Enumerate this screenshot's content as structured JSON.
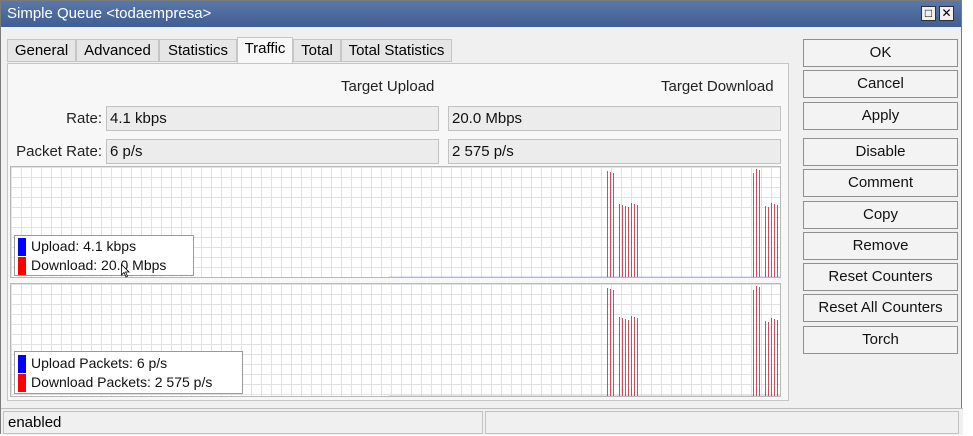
{
  "window": {
    "title": "Simple Queue <todaempresa>",
    "restore_glyph": "□",
    "close_glyph": "✕"
  },
  "tabs": [
    {
      "label": "General",
      "active": false
    },
    {
      "label": "Advanced",
      "active": false
    },
    {
      "label": "Statistics",
      "active": false
    },
    {
      "label": "Traffic",
      "active": true
    },
    {
      "label": "Total",
      "active": false
    },
    {
      "label": "Total Statistics",
      "active": false
    }
  ],
  "traffic": {
    "header_upload": "Target Upload",
    "header_download": "Target Download",
    "rate_label": "Rate:",
    "rate_upload": "4.1 kbps",
    "rate_download": "20.0 Mbps",
    "packet_rate_label": "Packet Rate:",
    "packet_rate_upload": "6 p/s",
    "packet_rate_download": "2 575 p/s"
  },
  "graphs": [
    {
      "legend": [
        {
          "text": "Upload:  4.1 kbps",
          "color": "#0000ff"
        },
        {
          "text": "Download:  20.0 Mbps",
          "color": "#ff0000"
        }
      ]
    },
    {
      "legend": [
        {
          "text": "Upload Packets:  6 p/s",
          "color": "#0000ff"
        },
        {
          "text": "Download Packets:  2 575 p/s",
          "color": "#ff0000"
        }
      ]
    }
  ],
  "buttons": [
    {
      "label": "OK"
    },
    {
      "label": "Cancel"
    },
    {
      "label": "Apply"
    },
    {
      "label": "Disable"
    },
    {
      "label": "Comment"
    },
    {
      "label": "Copy"
    },
    {
      "label": "Remove"
    },
    {
      "label": "Reset Counters"
    },
    {
      "label": "Reset All Counters"
    },
    {
      "label": "Torch"
    }
  ],
  "status": {
    "text": "enabled",
    "extra": ""
  },
  "colors": {
    "title_bar": "#4a6a9f",
    "download_series": "#c0304a",
    "upload_series": "#3050c0",
    "grid": "#e2e2e2"
  }
}
